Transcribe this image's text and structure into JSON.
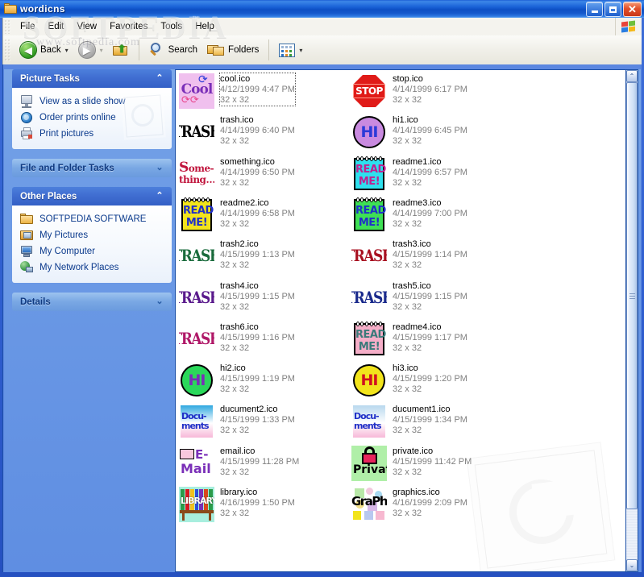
{
  "window": {
    "title": "wordicns",
    "title_icon": "folder-icon",
    "buttons": {
      "minimize": "–",
      "maximize": "❐",
      "close": "✕"
    }
  },
  "menubar": {
    "items": [
      "File",
      "Edit",
      "View",
      "Favorites",
      "Tools",
      "Help"
    ],
    "flag_icon": "windows-flag-icon"
  },
  "toolbar": {
    "back_label": "Back",
    "back_icon": "back-arrow-icon",
    "forward_icon": "forward-arrow-icon",
    "up_icon": "up-folder-icon",
    "search_label": "Search",
    "search_icon": "magnifier-icon",
    "folders_label": "Folders",
    "folders_icon": "folders-icon",
    "views_icon": "views-grid-icon",
    "dropdown_caret": "▾"
  },
  "sidebar": {
    "panels": [
      {
        "title": "Picture Tasks",
        "expanded": true,
        "chevron": "⌃",
        "header_style": "blue",
        "items": [
          {
            "label": "View as a slide show",
            "icon": "slideshow-icon"
          },
          {
            "label": "Order prints online",
            "icon": "globe-icon"
          },
          {
            "label": "Print pictures",
            "icon": "printer-icon"
          }
        ]
      },
      {
        "title": "File and Folder Tasks",
        "expanded": false,
        "chevron": "⌄",
        "header_style": "lightblue",
        "items": []
      },
      {
        "title": "Other Places",
        "expanded": true,
        "chevron": "⌃",
        "header_style": "blue",
        "items": [
          {
            "label": "SOFTPEDIA SOFTWARE",
            "icon": "folder-icon"
          },
          {
            "label": "My Pictures",
            "icon": "my-pictures-icon"
          },
          {
            "label": "My Computer",
            "icon": "my-computer-icon"
          },
          {
            "label": "My Network Places",
            "icon": "network-places-icon"
          }
        ]
      },
      {
        "title": "Details",
        "expanded": false,
        "chevron": "⌄",
        "header_style": "lightblue",
        "items": []
      }
    ]
  },
  "filelist": {
    "view_mode": "Thumbnails",
    "selected": "cool.ico",
    "files": [
      {
        "name": "cool.ico",
        "date": "4/12/1999 4:47 PM",
        "dim": "32 x 32",
        "col": 0,
        "row": 0,
        "art": "cool",
        "bg": "#f0c0ee",
        "fg": "#7a2fb8"
      },
      {
        "name": "stop.ico",
        "date": "4/14/1999 6:17 PM",
        "dim": "32 x 32",
        "col": 1,
        "row": 0,
        "art": "stop",
        "bg": "#ffffff",
        "fg": "#e01b18"
      },
      {
        "name": "trash.ico",
        "date": "4/14/1999 6:40 PM",
        "dim": "32 x 32",
        "col": 0,
        "row": 1,
        "art": "trash",
        "bg": "#ffffff",
        "fg": "#000000"
      },
      {
        "name": "hi1.ico",
        "date": "4/14/1999 6:45 PM",
        "dim": "32 x 32",
        "col": 1,
        "row": 1,
        "art": "hi",
        "bg": "#c98ae0",
        "fg": "#2a3ad8"
      },
      {
        "name": "something.ico",
        "date": "4/14/1999 6:50 PM",
        "dim": "32 x 32",
        "col": 0,
        "row": 2,
        "art": "something",
        "bg": "#ffffff",
        "fg": "#c0143c"
      },
      {
        "name": "readme1.ico",
        "date": "4/14/1999 6:57 PM",
        "dim": "32 x 32",
        "col": 1,
        "row": 2,
        "art": "readme",
        "bg": "#2ee0ee",
        "fg": "#c02090"
      },
      {
        "name": "readme2.ico",
        "date": "4/14/1999 6:58 PM",
        "dim": "32 x 32",
        "col": 0,
        "row": 3,
        "art": "readme",
        "bg": "#f2e41c",
        "fg": "#2030c8"
      },
      {
        "name": "readme3.ico",
        "date": "4/14/1999 7:00 PM",
        "dim": "32 x 32",
        "col": 1,
        "row": 3,
        "art": "readme",
        "bg": "#3ee055",
        "fg": "#2030c8"
      },
      {
        "name": "trash2.ico",
        "date": "4/15/1999 1:13 PM",
        "dim": "32 x 32",
        "col": 0,
        "row": 4,
        "art": "trash",
        "bg": "#ffffff",
        "fg": "#1a6b3c"
      },
      {
        "name": "trash3.ico",
        "date": "4/15/1999 1:14 PM",
        "dim": "32 x 32",
        "col": 1,
        "row": 4,
        "art": "trash",
        "bg": "#ffffff",
        "fg": "#a81020"
      },
      {
        "name": "trash4.ico",
        "date": "4/15/1999 1:15 PM",
        "dim": "32 x 32",
        "col": 0,
        "row": 5,
        "art": "trash",
        "bg": "#ffffff",
        "fg": "#5a1a8c"
      },
      {
        "name": "trash5.ico",
        "date": "4/15/1999 1:15 PM",
        "dim": "32 x 32",
        "col": 1,
        "row": 5,
        "art": "trash",
        "bg": "#ffffff",
        "fg": "#1a2a8c"
      },
      {
        "name": "trash6.ico",
        "date": "4/15/1999 1:16 PM",
        "dim": "32 x 32",
        "col": 0,
        "row": 6,
        "art": "trash",
        "bg": "#ffffff",
        "fg": "#b01868"
      },
      {
        "name": "readme4.ico",
        "date": "4/15/1999 1:17 PM",
        "dim": "32 x 32",
        "col": 1,
        "row": 6,
        "art": "readme",
        "bg": "#f5aec8",
        "fg": "#3a7a7a"
      },
      {
        "name": "hi2.ico",
        "date": "4/15/1999 1:19 PM",
        "dim": "32 x 32",
        "col": 0,
        "row": 7,
        "art": "hi",
        "bg": "#2ad85a",
        "fg": "#7a2fb8"
      },
      {
        "name": "hi3.ico",
        "date": "4/15/1999 1:20 PM",
        "dim": "32 x 32",
        "col": 1,
        "row": 7,
        "art": "hi",
        "bg": "#f2e41c",
        "fg": "#d01020"
      },
      {
        "name": "ducument2.ico",
        "date": "4/15/1999 1:33 PM",
        "dim": "32 x 32",
        "col": 0,
        "row": 8,
        "art": "documents",
        "bg": "#2fa8e0",
        "fg": "#2030c8"
      },
      {
        "name": "ducument1.ico",
        "date": "4/15/1999 1:34 PM",
        "dim": "32 x 32",
        "col": 1,
        "row": 8,
        "art": "documents",
        "bg": "#b8d8ee",
        "fg": "#2030c8"
      },
      {
        "name": "email.ico",
        "date": "4/15/1999 11:28 PM",
        "dim": "32 x 32",
        "col": 0,
        "row": 9,
        "art": "email",
        "bg": "#ffffff",
        "fg": "#7a2fb8"
      },
      {
        "name": "private.ico",
        "date": "4/15/1999 11:42 PM",
        "dim": "32 x 32",
        "col": 1,
        "row": 9,
        "art": "private",
        "bg": "#b0efa8",
        "fg": "#000000"
      },
      {
        "name": "library.ico",
        "date": "4/16/1999 1:50 PM",
        "dim": "32 x 32",
        "col": 0,
        "row": 10,
        "art": "library",
        "bg": "#a8eede",
        "fg": "#000000"
      },
      {
        "name": "graphics.ico",
        "date": "4/16/1999 2:09 PM",
        "dim": "32 x 32",
        "col": 1,
        "row": 10,
        "art": "graphics",
        "bg": "#ffffff",
        "fg": "#000000"
      }
    ]
  },
  "scrollbar": {
    "up_arrow": "⌃",
    "down_arrow": "⌄"
  },
  "watermark": {
    "big": "SOFTPEDIA",
    "tm": "™",
    "small": "www.softpedia.com"
  },
  "colors": {
    "title_blue": "#0d4fc4",
    "panel_blue": "#3f6cd0",
    "content_blue": "#6e9ce6",
    "close_red": "#e2502a"
  }
}
